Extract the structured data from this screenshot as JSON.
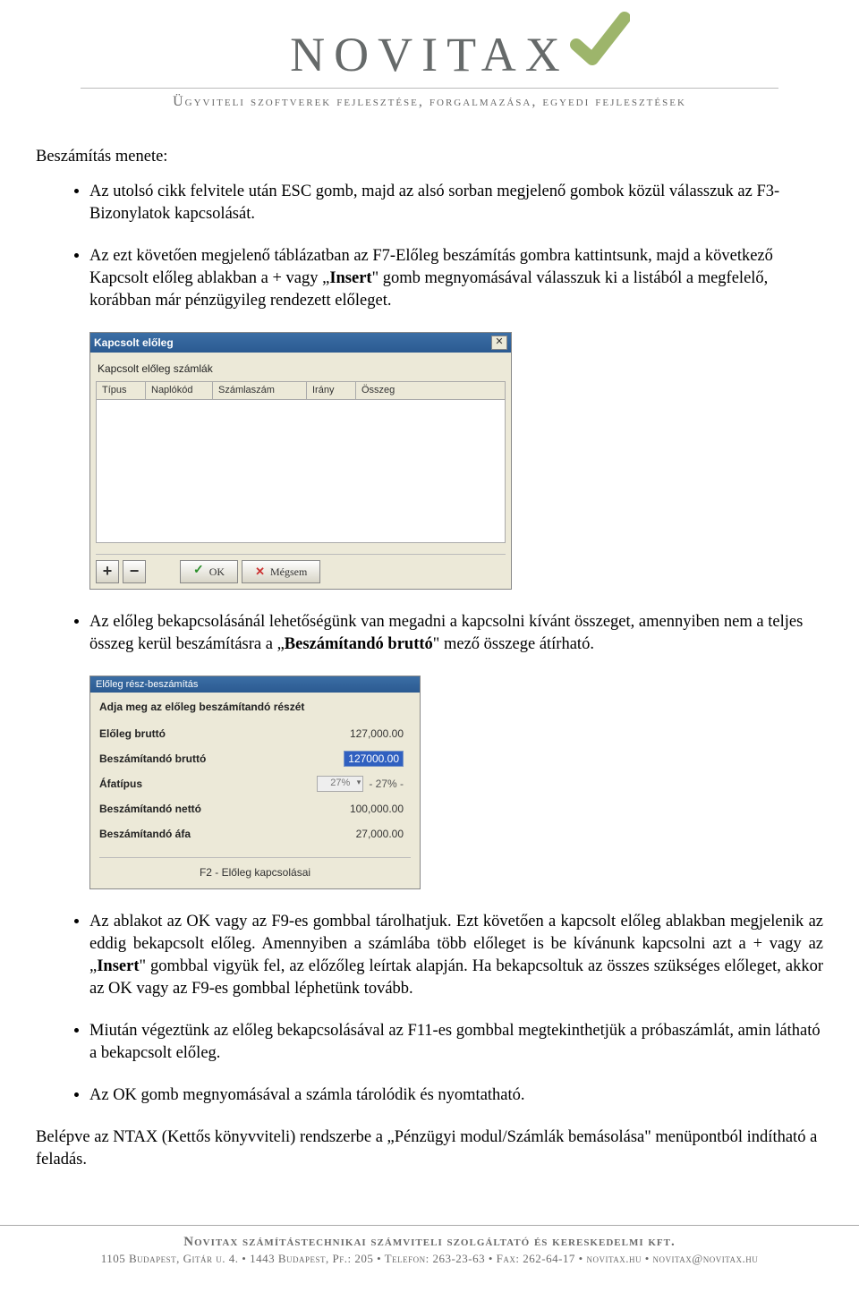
{
  "header": {
    "brand": "NOVITAX",
    "tagline": "Ügyviteli szoftverek fejlesztése, forgalmazása, egyedi fejlesztések"
  },
  "body": {
    "heading": "Beszámítás menete:",
    "bullets": {
      "b1": "Az utolsó cikk felvitele után ESC gomb, majd az alsó sorban megjelenő gombok közül válasszuk az F3-Bizonylatok kapcsolását.",
      "b2_a": "Az ezt követően megjelenő táblázatban az F7-Előleg beszámítás gombra kattintsunk, majd a következő Kapcsolt előleg ablakban a + vagy „",
      "b2_insert": "Insert",
      "b2_b": "\" gomb megnyomásával válasszuk ki a listából a megfelelő, korábban már pénzügyileg rendezett előleget.",
      "b3_a": "Az előleg bekapcsolásánál lehetőségünk van megadni a kapcsolni kívánt összeget, amennyiben nem a teljes összeg kerül beszámításra a „",
      "b3_bold": "Beszámítandó bruttó",
      "b3_b": "\" mező összege átírható.",
      "b4_a": "Az ablakot az OK vagy az F9-es gombbal tárolhatjuk. Ezt követően a kapcsolt előleg ablakban megjelenik az eddig bekapcsolt előleg. Amennyiben a számlába több előleget is be kívánunk kapcsolni azt a + vagy az „",
      "b4_insert": "Insert",
      "b4_b": "\" gombbal vigyük fel, az előzőleg leírtak alapján. Ha bekapcsoltuk az összes szükséges előleget, akkor az OK vagy az F9-es gombbal léphetünk tovább.",
      "b5": "Miután végeztünk az előleg bekapcsolásával az F11-es gombbal megtekinthetjük a próbaszámlát, amin látható a bekapcsolt előleg.",
      "b6": "Az OK gomb megnyomásával a számla tárolódik és nyomtatható."
    },
    "para_end": "Belépve az NTAX (Kettős könyvviteli) rendszerbe a „Pénzügyi modul/Számlák bemásolása\" menüpontból indítható a feladás."
  },
  "dlg1": {
    "title": "Kapcsolt előleg",
    "subtitle": "Kapcsolt előleg számlák",
    "cols": {
      "c1": "Típus",
      "c2": "Naplókód",
      "c3": "Számlaszám",
      "c4": "Irány",
      "c5": "Összeg"
    },
    "btn_plus": "+",
    "btn_minus": "−",
    "btn_ok": "OK",
    "btn_cancel": "Mégsem"
  },
  "dlg2": {
    "title": "Előleg rész-beszámítás",
    "prompt": "Adja meg az előleg beszámítandó részét",
    "rows": {
      "r1l": "Előleg bruttó",
      "r1v": "127,000.00",
      "r2l": "Beszámítandó bruttó",
      "r2v": "127000.00",
      "r3l": "Áfatípus",
      "r3dd": "27%",
      "r3t": "- 27% -",
      "r4l": "Beszámítandó nettó",
      "r4v": "100,000.00",
      "r5l": "Beszámítandó áfa",
      "r5v": "27,000.00"
    },
    "bottom": "F2 - Előleg kapcsolásai"
  },
  "footer": {
    "line1": "Novitax számítástechnikai számviteli szolgáltató és kereskedelmi kft.",
    "line2": "1105 Budapest, Gitár u. 4. • 1443 Budapest, Pf.: 205 • Telefon: 263-23-63 • Fax: 262-64-17 • novitax.hu • novitax@novitax.hu"
  }
}
